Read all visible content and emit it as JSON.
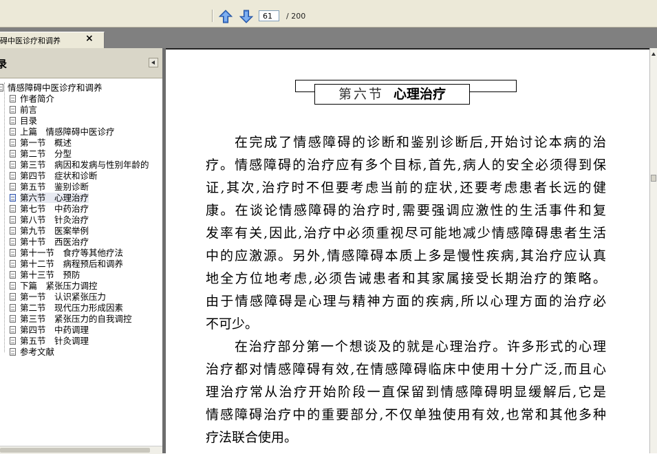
{
  "toolbar": {
    "current_page": "61",
    "total_pages": "/ 200"
  },
  "tab": {
    "label": "碍中医诊疗和调养",
    "close_glyph": "×"
  },
  "panel": {
    "title": "录"
  },
  "bookmarks": [
    {
      "label": "情感障碍中医诊疗和调养",
      "level": 0
    },
    {
      "label": "作者简介",
      "level": 1
    },
    {
      "label": "前言",
      "level": 1
    },
    {
      "label": "目录",
      "level": 1
    },
    {
      "label": "上篇　情感障碍中医诊疗",
      "level": 1
    },
    {
      "label": "第一节　概述",
      "level": 1
    },
    {
      "label": "第二节　分型",
      "level": 1
    },
    {
      "label": "第三节　病因和发病与性别年龄的",
      "level": 1
    },
    {
      "label": "第四节　症状和诊断",
      "level": 1
    },
    {
      "label": "第五节　鉴别诊断",
      "level": 1
    },
    {
      "label": "第六节　心理治疗",
      "level": 1,
      "active": true
    },
    {
      "label": "第七节　中药治疗",
      "level": 1
    },
    {
      "label": "第八节　针灸治疗",
      "level": 1
    },
    {
      "label": "第九节　医案举例",
      "level": 1
    },
    {
      "label": "第十节　西医治疗",
      "level": 1
    },
    {
      "label": "第十一节　食疗等其他疗法",
      "level": 1
    },
    {
      "label": "第十二节　病程预后和调养",
      "level": 1
    },
    {
      "label": "第十三节　预防",
      "level": 1
    },
    {
      "label": "下篇　紧张压力调控",
      "level": 1
    },
    {
      "label": "第一节　认识紧张压力",
      "level": 1
    },
    {
      "label": "第二节　现代压力形成因素",
      "level": 1
    },
    {
      "label": "第三节　紧张压力的自我调控",
      "level": 1
    },
    {
      "label": "第四节　中药调理",
      "level": 1
    },
    {
      "label": "第五节　针灸调理",
      "level": 1
    },
    {
      "label": "参考文献",
      "level": 1
    }
  ],
  "document": {
    "heading_number": "第六节",
    "heading_title": "心理治疗",
    "lines": [
      {
        "text": "在完成了情感障碍的诊断和鉴别诊断后,开始讨论本病的治",
        "indent": true
      },
      {
        "text": "疗。情感障碍的治疗应有多个目标,首先,病人的安全必须得到保"
      },
      {
        "text": "证,其次,治疗时不但要考虑当前的症状,还要考虑患者长远的健"
      },
      {
        "text": "康。在谈论情感障碍的治疗时,需要强调应激性的生活事件和复"
      },
      {
        "text": "发率有关,因此,治疗中必须重视尽可能地减少情感障碍患者生活"
      },
      {
        "text": "中的应激源。另外,情感障碍本质上多是慢性疾病,其治疗应认真"
      },
      {
        "text": "地全方位地考虑,必须告诫患者和其家属接受长期治疗的策略。"
      },
      {
        "text": "由于情感障碍是心理与精神方面的疾病,所以心理方面的治疗必"
      },
      {
        "text": "不可少。",
        "last": true
      },
      {
        "text": "在治疗部分第一个想谈及的就是心理治疗。许多形式的心理",
        "indent": true
      },
      {
        "text": "治疗都对情感障碍有效,在情感障碍临床中使用十分广泛,而且心"
      },
      {
        "text": "理治疗常从治疗开始阶段一直保留到情感障碍明显缓解后,它是"
      },
      {
        "text": "情感障碍治疗中的重要部分,不仅单独使用有效,也常和其他多种"
      },
      {
        "text": "疗法联合使用。",
        "last": true
      }
    ]
  }
}
